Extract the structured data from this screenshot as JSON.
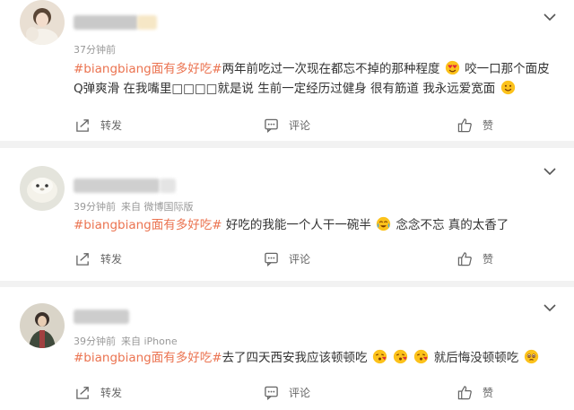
{
  "posts": [
    {
      "time": "37分钟前",
      "source": "",
      "tag": "#biangbiang面有多好吃#",
      "text_a": "两年前吃过一次现在都忘不掉的那种程度",
      "text_b": "咬一口那个面皮Q弹爽滑 在我嘴里□□□□就是说 生前一定经历过健身 很有筋道 我永远爱宽面",
      "forward": "转发",
      "comment": "评论",
      "like": "赞"
    },
    {
      "time": "39分钟前",
      "source": "来自 微博国际版",
      "tag": "#biangbiang面有多好吃#",
      "text_a": "好吃的我能一个人干一碗半",
      "text_b": "念念不忘 真的太香了",
      "forward": "转发",
      "comment": "评论",
      "like": "赞"
    },
    {
      "time": "39分钟前",
      "source": "来自 iPhone",
      "tag": "#biangbiang面有多好吃#",
      "text_a": "去了四天西安我应该顿顿吃",
      "text_b": "就后悔没顿顿吃",
      "forward": "转发",
      "comment": "评论",
      "like": "赞"
    }
  ],
  "icons": {
    "menu": "chevron-down-icon",
    "forward": "share-icon",
    "comment": "comment-icon",
    "like": "thumbs-up-icon"
  },
  "colors": {
    "tag": "#eb7350",
    "meta": "#999999",
    "text": "#333333"
  }
}
